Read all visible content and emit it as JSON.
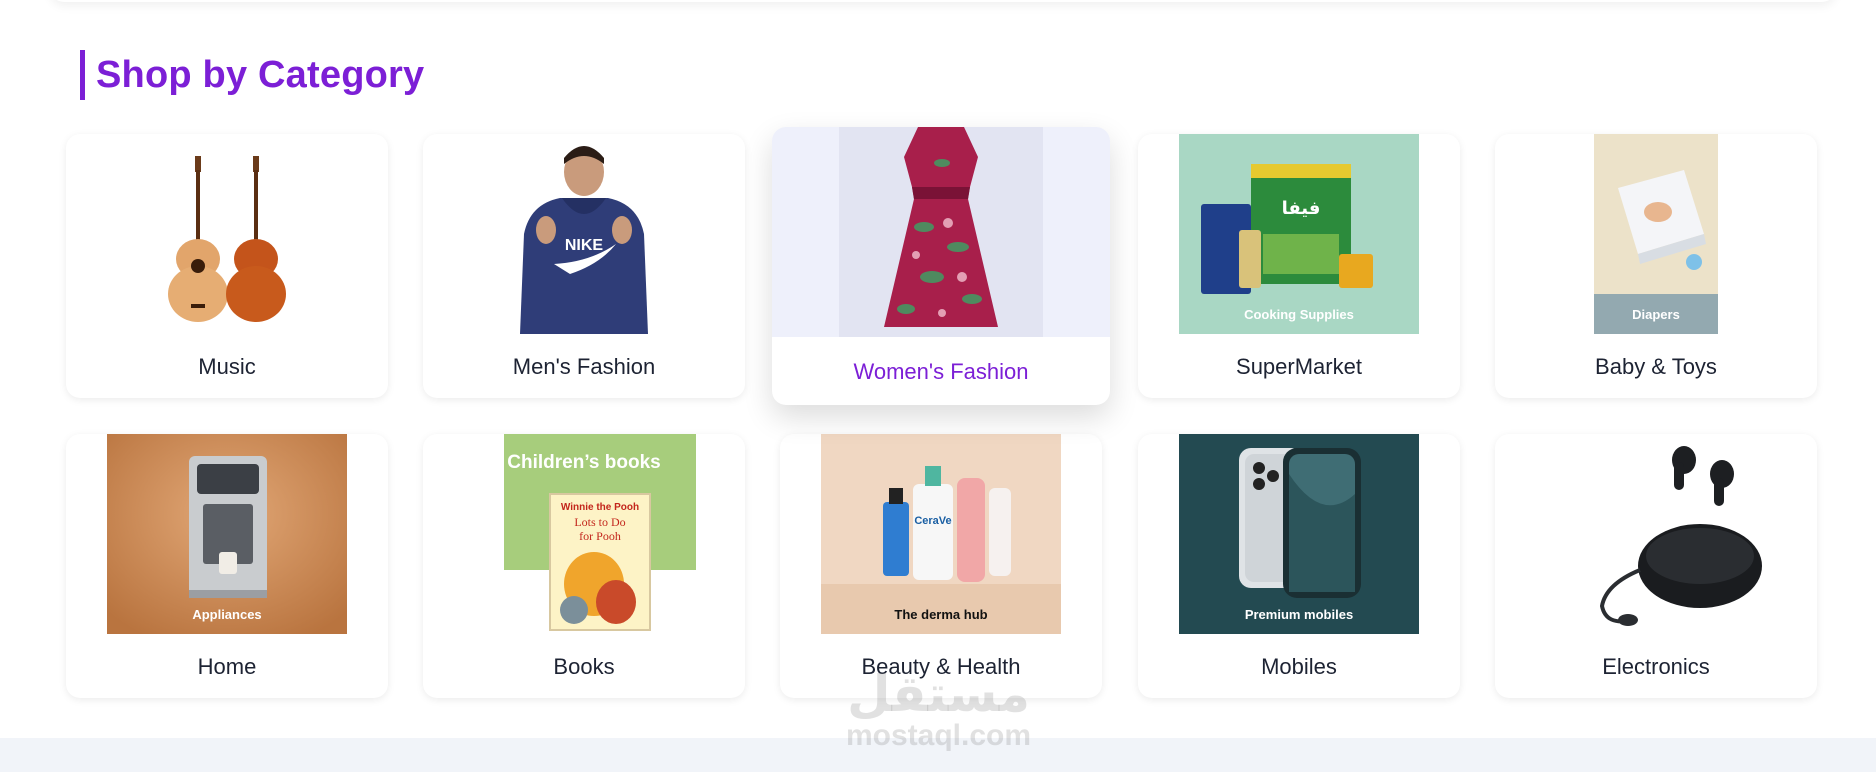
{
  "section": {
    "title": "Shop by Category"
  },
  "categories": [
    {
      "label": "Music"
    },
    {
      "label": "Men's Fashion"
    },
    {
      "label": "Women's Fashion"
    },
    {
      "label": "SuperMarket",
      "overlay": "Cooking Supplies"
    },
    {
      "label": "Baby & Toys",
      "overlay": "Diapers"
    },
    {
      "label": "Home",
      "overlay": "Appliances"
    },
    {
      "label": "Books",
      "overlay": "Children’s books",
      "book_title": "Lots to Do for Pooh",
      "book_brand": "Winnie the Pooh"
    },
    {
      "label": "Beauty & Health",
      "overlay": "The derma hub"
    },
    {
      "label": "Mobiles",
      "overlay": "Premium mobiles"
    },
    {
      "label": "Electronics"
    }
  ],
  "watermark": {
    "arabic": "مستقل",
    "latin": "mostaql.com"
  },
  "colors": {
    "accent": "#7c1fd6",
    "text": "#1d2333",
    "footer": "#f1f4f9"
  }
}
